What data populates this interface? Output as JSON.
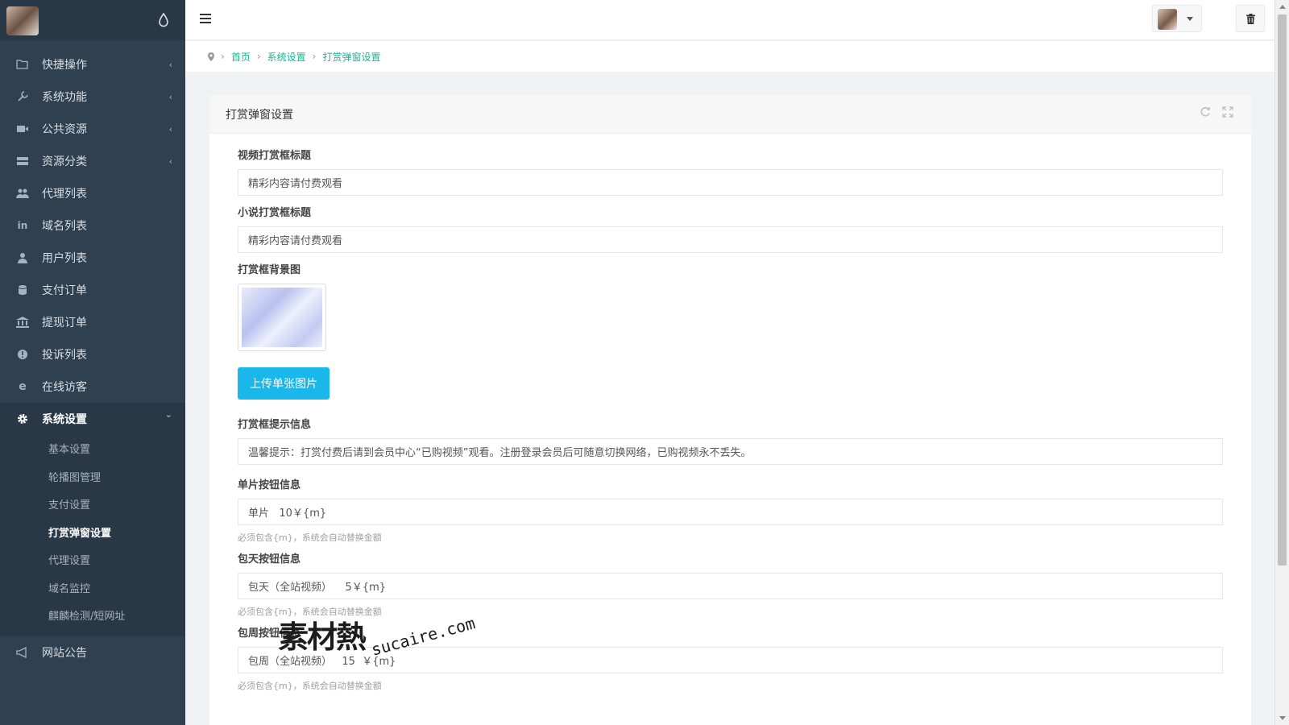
{
  "sidebar": {
    "items": [
      {
        "label": "快捷操作",
        "icon": "folder-icon",
        "caret": "‹"
      },
      {
        "label": "系统功能",
        "icon": "wrench-icon",
        "caret": "‹"
      },
      {
        "label": "公共资源",
        "icon": "video-icon",
        "caret": "‹"
      },
      {
        "label": "资源分类",
        "icon": "list-icon",
        "caret": "‹"
      },
      {
        "label": "代理列表",
        "icon": "users-icon",
        "caret": ""
      },
      {
        "label": "域名列表",
        "icon": "linkedin-icon",
        "caret": ""
      },
      {
        "label": "用户列表",
        "icon": "user-icon",
        "caret": ""
      },
      {
        "label": "支付订单",
        "icon": "database-icon",
        "caret": ""
      },
      {
        "label": "提现订单",
        "icon": "bank-icon",
        "caret": ""
      },
      {
        "label": "投诉列表",
        "icon": "info-icon",
        "caret": ""
      },
      {
        "label": "在线访客",
        "icon": "ie-icon",
        "caret": ""
      },
      {
        "label": "系统设置",
        "icon": "gear-icon",
        "caret": "⌄"
      }
    ],
    "submenu": [
      "基本设置",
      "轮播图管理",
      "支付设置",
      "打赏弹窗设置",
      "代理设置",
      "域名监控",
      "麒麟检测/短网址"
    ],
    "last_item": {
      "label": "网站公告",
      "icon": "bullhorn-icon"
    }
  },
  "breadcrumb": {
    "home": "首页",
    "level1": "系统设置",
    "level2": "打赏弹窗设置"
  },
  "panel": {
    "title": "打赏弹窗设置",
    "video_title": {
      "label": "视频打赏框标题",
      "value": "精彩内容请付费观看"
    },
    "novel_title": {
      "label": "小说打赏框标题",
      "value": "精彩内容请付费观看"
    },
    "bg_image": {
      "label": "打赏框背景图"
    },
    "upload_label": "上传单张图片",
    "tip": {
      "label": "打赏框提示信息",
      "value": "温馨提示：打赏付费后请到会员中心“已购视频”观看。注册登录会员后可随意切换网络，已购视频永不丢失。"
    },
    "single": {
      "label": "单片按钮信息",
      "value": "单片   10￥{m}",
      "help": "必须包含{m}，系统会自动替换金额"
    },
    "daily": {
      "label": "包天按钮信息",
      "value": "包天（全站视频）    5￥{m}",
      "help": "必须包含{m}，系统会自动替换金额"
    },
    "weekly": {
      "label": "包周按钮信息",
      "value": "包周（全站视频）   15  ￥{m}",
      "help": "必须包含{m}，系统会自动替换金额"
    }
  },
  "watermark": {
    "cn": "素材熱",
    "en": "sucaire.com"
  },
  "colors": {
    "sidebar": "#2f4050",
    "accent": "#1ab394",
    "button": "#1ab7ea"
  }
}
